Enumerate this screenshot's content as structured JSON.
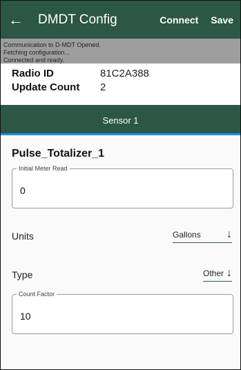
{
  "app_bar": {
    "title": "DMDT Config",
    "connect_label": "Connect",
    "save_label": "Save",
    "back_icon": "←"
  },
  "status_log": [
    "Communication to D-MDT Opened.",
    "Fetching configuration...",
    "Connected and ready."
  ],
  "device": {
    "radio_id_label": "Radio ID",
    "radio_id_value": "81C2A388",
    "update_count_label": "Update Count",
    "update_count_value": "2"
  },
  "tab": {
    "label": "Sensor 1"
  },
  "sensor": {
    "name": "Pulse_Totalizer_1",
    "initial_meter_read": {
      "label": "Initial Meter Read",
      "value": "0"
    },
    "units": {
      "label": "Units",
      "value": "Gallons"
    },
    "type": {
      "label": "Type",
      "value": "Other"
    },
    "count_factor": {
      "label": "Count Factor",
      "value": "10"
    }
  },
  "colors": {
    "primary": "#2b5744",
    "status_bg": "#9e9e9e",
    "tab_indicator": "#1e8fe0"
  },
  "icons": {
    "back": "arrow-left-icon",
    "dropdown": "arrow-down-icon"
  }
}
